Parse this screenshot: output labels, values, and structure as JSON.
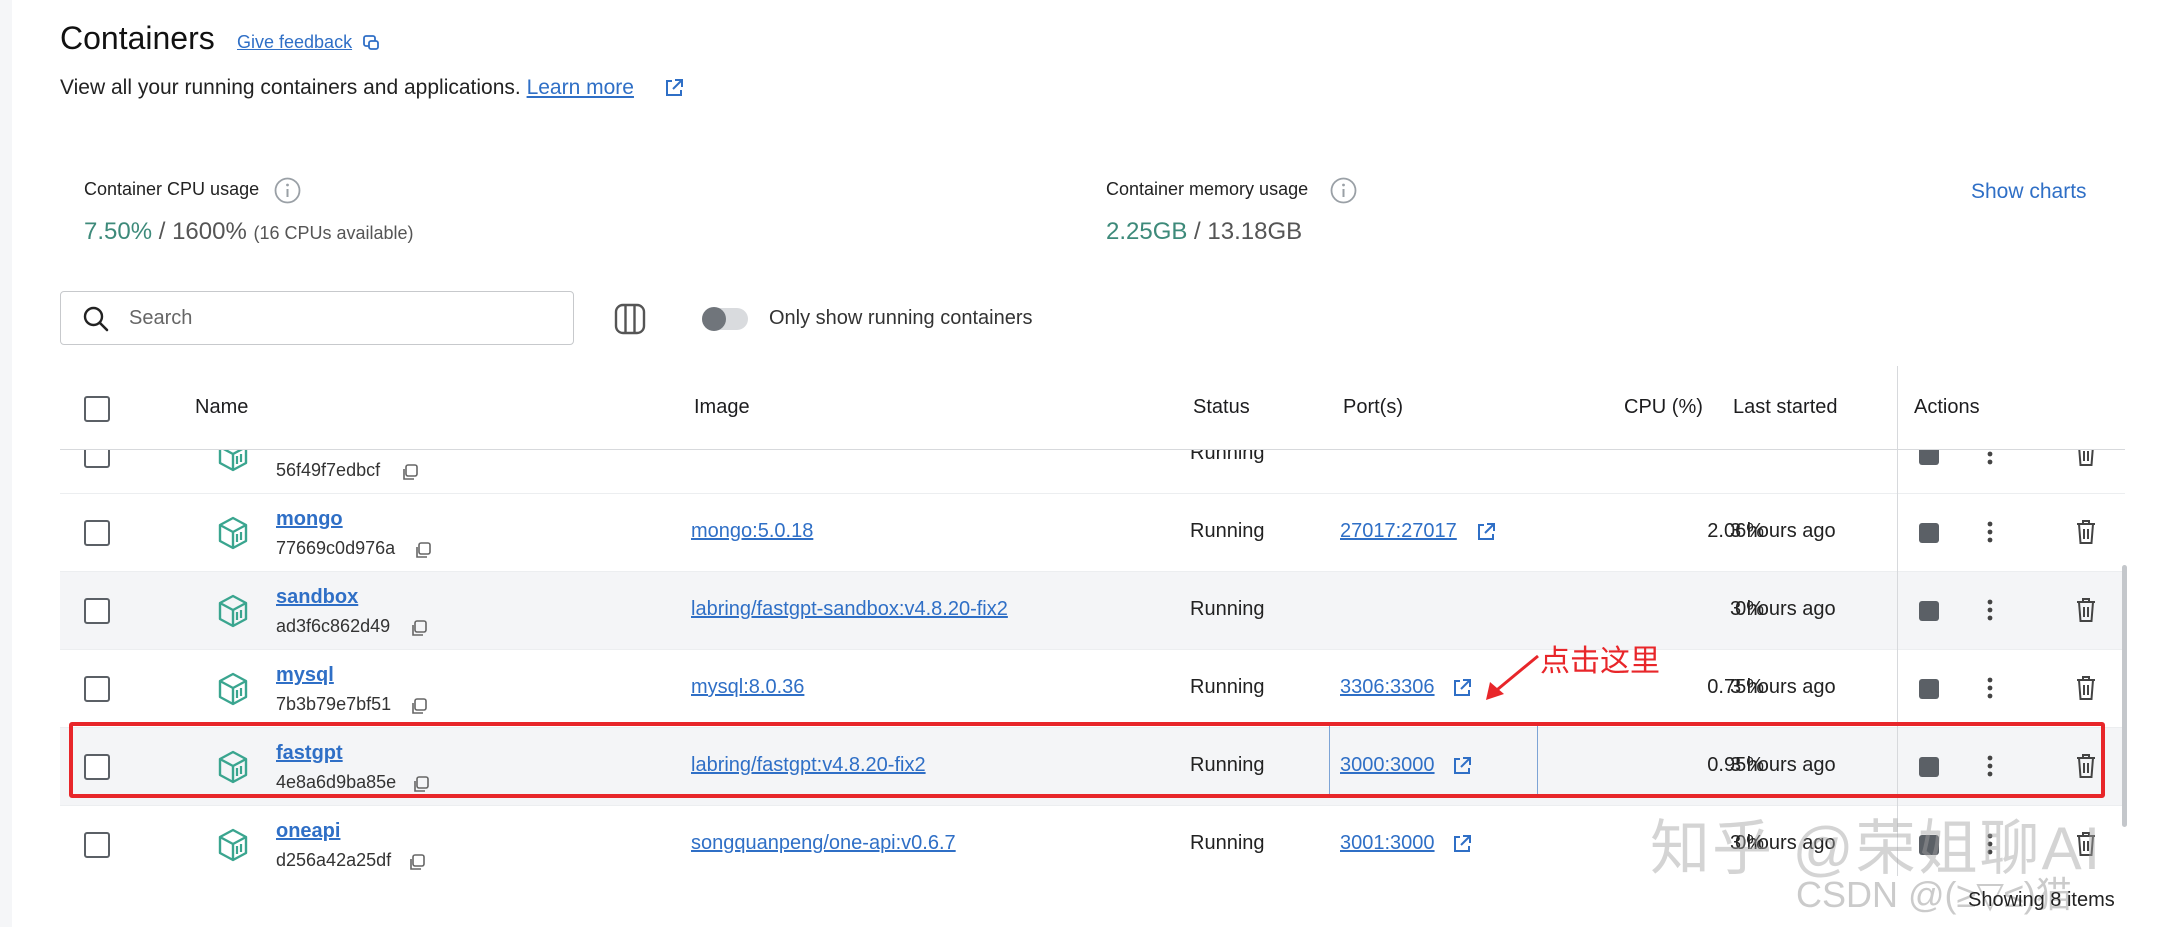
{
  "page": {
    "title": "Containers",
    "feedback_label": "Give feedback",
    "subtitle": "View all your running containers and applications.",
    "learn_more": "Learn more"
  },
  "metrics": {
    "cpu": {
      "label": "Container CPU usage",
      "used": "7.50%",
      "sep": " / ",
      "total": "1600%",
      "note": "(16 CPUs available)"
    },
    "memory": {
      "label": "Container memory usage",
      "used": "2.25GB",
      "sep": " / ",
      "total": "13.18GB"
    },
    "show_charts": "Show charts"
  },
  "toolbar": {
    "search_placeholder": "Search",
    "toggle_label": "Only show running containers",
    "toggle_on": false
  },
  "table": {
    "headers": {
      "name": "Name",
      "image": "Image",
      "status": "Status",
      "ports": "Port(s)",
      "cpu": "CPU (%)",
      "last_started": "Last started",
      "actions": "Actions"
    },
    "rows": [
      {
        "name": "",
        "id": "56f49f7edbcf",
        "image": "",
        "status": "Running",
        "port": "",
        "cpu": "",
        "last_started": ""
      },
      {
        "name": "mongo",
        "id": "77669c0d976a",
        "image": "mongo:5.0.18",
        "status": "Running",
        "port": "27017:27017",
        "cpu": "2.06%",
        "last_started": "3 hours ago"
      },
      {
        "name": "sandbox",
        "id": "ad3f6c862d49",
        "image": "labring/fastgpt-sandbox:v4.8.20-fix2",
        "status": "Running",
        "port": "",
        "cpu": "0%",
        "last_started": "3 hours ago"
      },
      {
        "name": "mysql",
        "id": "7b3b79e7bf51",
        "image": "mysql:8.0.36",
        "status": "Running",
        "port": "3306:3306",
        "cpu": "0.75%",
        "last_started": "3 hours ago"
      },
      {
        "name": "fastgpt",
        "id": "4e8a6d9ba85e",
        "image": "labring/fastgpt:v4.8.20-fix2",
        "status": "Running",
        "port": "3000:3000",
        "cpu": "0.95%",
        "last_started": "3 hours ago"
      },
      {
        "name": "oneapi",
        "id": "d256a42a25df",
        "image": "songquanpeng/one-api:v0.6.7",
        "status": "Running",
        "port": "3001:3000",
        "cpu": "0%",
        "last_started": "3 hours ago"
      }
    ]
  },
  "annotation": {
    "text": "点击这里",
    "color": "#e8262a"
  },
  "footer": {
    "showing": "Showing 8 items"
  },
  "watermark": {
    "line1": "知乎 @荣姐聊AI",
    "line2": "CSDN @(≥▽≤)猫"
  },
  "colors": {
    "link": "#2f6fc6",
    "accent_green": "#3d8a7a",
    "container_icon": "#3aa58f"
  }
}
